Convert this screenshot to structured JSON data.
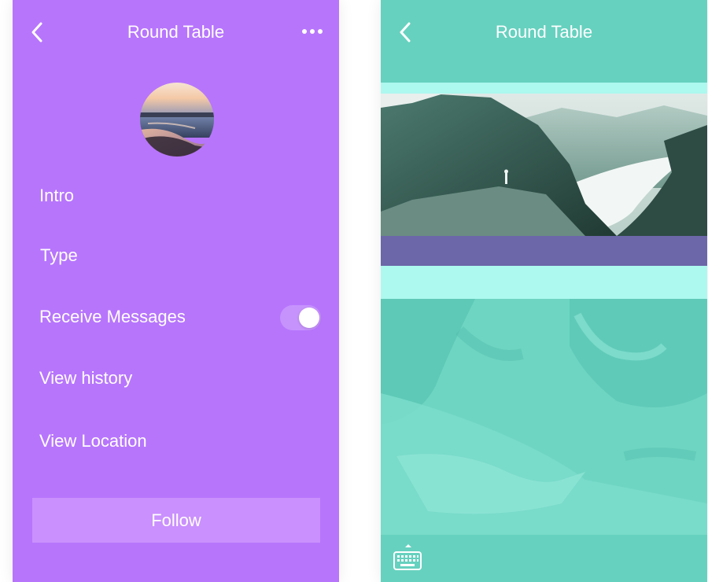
{
  "left": {
    "title": "Round Table",
    "menu": {
      "intro": "Intro",
      "type": "Type",
      "receive_messages": "Receive Messages",
      "view_history": "View history",
      "view_location": "View Location"
    },
    "receive_messages_on": true,
    "follow_label": "Follow"
  },
  "right": {
    "title": "Round Table"
  },
  "colors": {
    "left_bg": "#b775fc",
    "follow_bg": "#ca90fd",
    "right_bg": "#66d1bf",
    "light_strip": "#adf8ef",
    "purple_band": "#6b67a8"
  },
  "icons": [
    "back-chevron-icon",
    "more-dots-icon",
    "keyboard-icon"
  ]
}
